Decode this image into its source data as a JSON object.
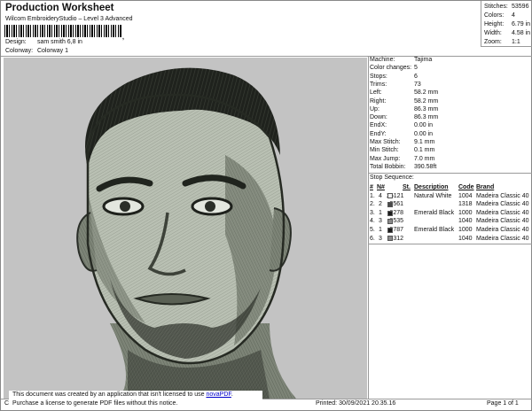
{
  "header": {
    "title": "Production Worksheet",
    "subtitle": "Wilcom EmbroideryStudio – Level 3 Advanced",
    "barcode_tick": ",",
    "design_label": "Design:",
    "design_value": "sam smith 6,8 in",
    "colorway_label": "Colorway:",
    "colorway_value": "Colorway 1"
  },
  "stats": [
    {
      "label": "Stitches:",
      "value": "53596"
    },
    {
      "label": "Colors:",
      "value": "4"
    },
    {
      "label": "Height:",
      "value": "6.79 in"
    },
    {
      "label": "Width:",
      "value": "4.58 in"
    },
    {
      "label": "Zoom:",
      "value": "1:1"
    }
  ],
  "machine_info": [
    {
      "label": "Machine:",
      "value": "Tajima"
    },
    {
      "label": "Color changes:",
      "value": "5"
    },
    {
      "label": "Stops:",
      "value": "6"
    },
    {
      "label": "Trims:",
      "value": "73"
    },
    {
      "label": "Left:",
      "value": "58.2 mm"
    },
    {
      "label": "Right:",
      "value": "58.2 mm"
    },
    {
      "label": "Up:",
      "value": "86.3 mm"
    },
    {
      "label": "Down:",
      "value": "86.3 mm"
    },
    {
      "label": "EndX:",
      "value": "0.00 in"
    },
    {
      "label": "EndY:",
      "value": "0.00 in"
    },
    {
      "label": "Max Stitch:",
      "value": "9.1 mm"
    },
    {
      "label": "Min Stitch:",
      "value": "0.1 mm"
    },
    {
      "label": "Max Jump:",
      "value": "7.0 mm"
    },
    {
      "label": "Total Bobbin:",
      "value": "390.58ft"
    }
  ],
  "stop_sequence": {
    "title": "Stop Sequence:",
    "columns": [
      "#",
      "N#",
      "St.",
      "Description",
      "Code",
      "Brand"
    ],
    "rows": [
      {
        "num": "1.",
        "n": "4",
        "swatch": "#f2f2f2",
        "st": "25121",
        "desc": "Natural White",
        "code": "1004",
        "brand": "Madeira Classic 40"
      },
      {
        "num": "2.",
        "n": "2",
        "swatch": "#4a4a4a",
        "st": "2561",
        "desc": "",
        "code": "1318",
        "brand": "Madeira Classic 40"
      },
      {
        "num": "3.",
        "n": "1",
        "swatch": "#1c1c1c",
        "st": "6278",
        "desc": "Emerald Black",
        "code": "1000",
        "brand": "Madeira Classic 40"
      },
      {
        "num": "4.",
        "n": "3",
        "swatch": "#8a8a8a",
        "st": "8535",
        "desc": "",
        "code": "1040",
        "brand": "Madeira Classic 40"
      },
      {
        "num": "5.",
        "n": "1",
        "swatch": "#1c1c1c",
        "st": "9787",
        "desc": "Emerald Black",
        "code": "1000",
        "brand": "Madeira Classic 40"
      },
      {
        "num": "6.",
        "n": "3",
        "swatch": "#8a8a8a",
        "st": "1312",
        "desc": "",
        "code": "1040",
        "brand": "Madeira Classic 40"
      }
    ]
  },
  "notice": {
    "line1_prefix": "This document was created by an application that isn't licensed to use ",
    "link": "novaPDF",
    "line1_suffix": ".",
    "line2": "Purchase a license to generate PDF files without this notice."
  },
  "footer": {
    "left": "Cr",
    "printed": "Printed: 30/09/2021 20.35.16",
    "page": "Page 1 of 1"
  },
  "colors": {
    "canvas_bg": "#c3c3c3",
    "thread_dark": "#2a2e28",
    "thread_mid": "#6e7468",
    "thread_light": "#c8cec2"
  }
}
